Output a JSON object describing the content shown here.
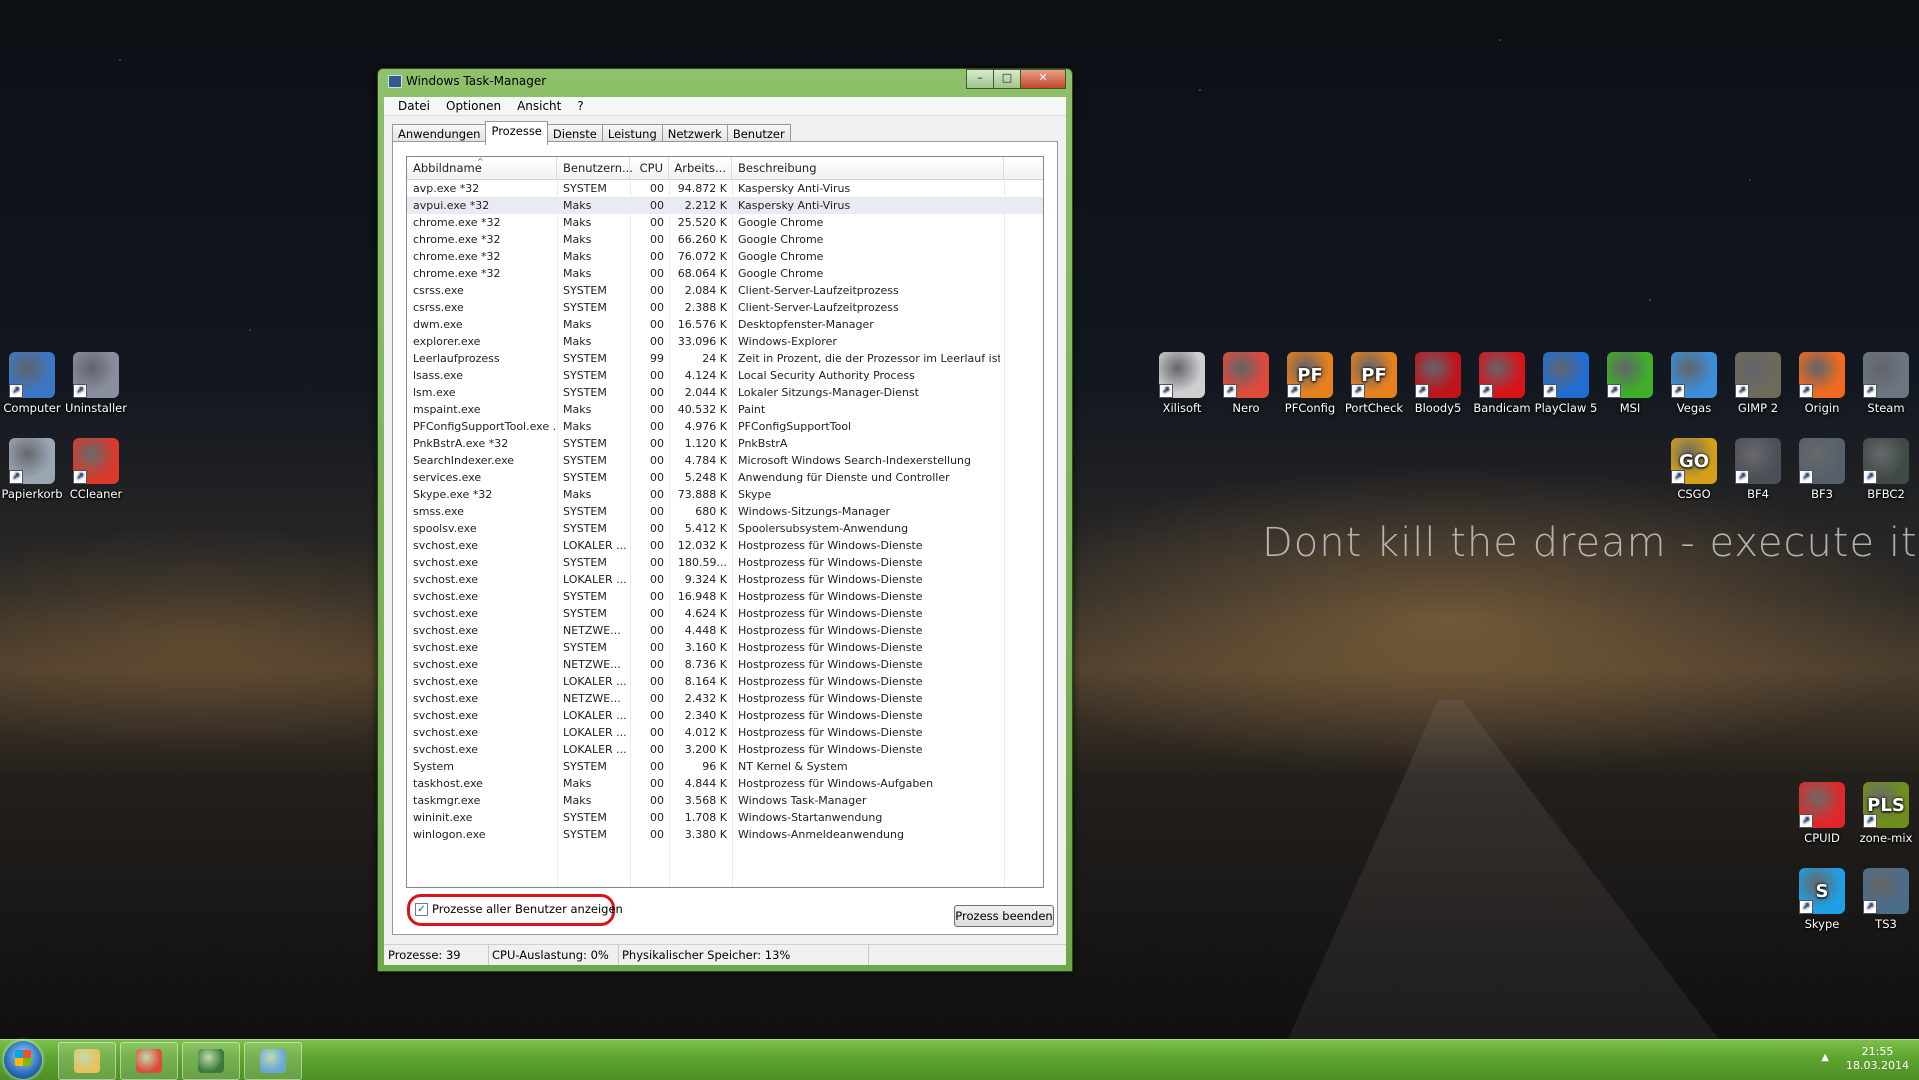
{
  "desktop": {
    "slogan": "Dont kill the dream - execute it",
    "left_icons": [
      {
        "label": "Computer",
        "icon": "computer-icon",
        "color": "#3a78c6"
      },
      {
        "label": "Uninstaller",
        "icon": "uninstaller-icon",
        "color": "#8a8fa0"
      },
      {
        "label": "Papierkorb",
        "icon": "recycle-bin-icon",
        "color": "#9aa6b4"
      },
      {
        "label": "CCleaner",
        "icon": "ccleaner-icon",
        "color": "#d93a2b"
      }
    ],
    "right_icons_row1": [
      {
        "label": "Xilisoft",
        "icon": "xilisoft-icon",
        "color": "#cfcfcf"
      },
      {
        "label": "Nero",
        "icon": "nero-icon",
        "color": "#e04a3a"
      },
      {
        "label": "PFConfig",
        "icon": "pfconfig-icon",
        "color": "#e8801c",
        "glyph": "PF"
      },
      {
        "label": "PortCheck",
        "icon": "portcheck-icon",
        "color": "#e8801c",
        "glyph": "PF"
      },
      {
        "label": "Bloody5",
        "icon": "bloody5-icon",
        "color": "#c0141b"
      },
      {
        "label": "Bandicam",
        "icon": "bandicam-icon",
        "color": "#d8141a"
      },
      {
        "label": "PlayClaw 5",
        "icon": "playclaw-icon",
        "color": "#1f6ed4"
      },
      {
        "label": "MSI",
        "icon": "msi-icon",
        "color": "#3fae2a"
      },
      {
        "label": "Vegas",
        "icon": "vegas-icon",
        "color": "#3b8fd8"
      },
      {
        "label": "GIMP 2",
        "icon": "gimp-icon",
        "color": "#6e6a5a"
      },
      {
        "label": "Origin",
        "icon": "origin-icon",
        "color": "#f06b1f"
      },
      {
        "label": "Steam",
        "icon": "steam-icon",
        "color": "#6c7580"
      }
    ],
    "right_icons_row2": [
      {
        "label": "CSGO",
        "icon": "csgo-icon",
        "color": "#d4a017",
        "glyph": "GO"
      },
      {
        "label": "BF4",
        "icon": "bf4-icon",
        "color": "#4b4f57"
      },
      {
        "label": "BF3",
        "icon": "bf3-icon",
        "color": "#56606c"
      },
      {
        "label": "BFBC2",
        "icon": "bfbc2-icon",
        "color": "#3f4a45"
      }
    ],
    "right_icons_row3": [
      {
        "label": "CPUID",
        "icon": "cpuid-icon",
        "color": "#e0282a"
      },
      {
        "label": "zone-mix",
        "icon": "zone-mix-icon",
        "color": "#6e8f1c",
        "glyph": "PLS"
      }
    ],
    "right_icons_row4": [
      {
        "label": "Skype",
        "icon": "skype-icon",
        "color": "#1ea0e6",
        "glyph": "S"
      },
      {
        "label": "TS3",
        "icon": "teamspeak-icon",
        "color": "#4a6d8c"
      }
    ]
  },
  "window": {
    "title": "Windows Task-Manager",
    "menu": [
      "Datei",
      "Optionen",
      "Ansicht",
      "?"
    ],
    "tabs": [
      "Anwendungen",
      "Prozesse",
      "Dienste",
      "Leistung",
      "Netzwerk",
      "Benutzer"
    ],
    "active_tab": "Prozesse",
    "columns": [
      "Abbildname",
      "Benutzern...",
      "CPU",
      "Arbeits...",
      "Beschreibung"
    ],
    "processes": [
      [
        "avp.exe *32",
        "SYSTEM",
        "00",
        "94.872 K",
        "Kaspersky Anti-Virus"
      ],
      [
        "avpui.exe *32",
        "Maks",
        "00",
        "2.212 K",
        "Kaspersky Anti-Virus"
      ],
      [
        "chrome.exe *32",
        "Maks",
        "00",
        "25.520 K",
        "Google Chrome"
      ],
      [
        "chrome.exe *32",
        "Maks",
        "00",
        "66.260 K",
        "Google Chrome"
      ],
      [
        "chrome.exe *32",
        "Maks",
        "00",
        "76.072 K",
        "Google Chrome"
      ],
      [
        "chrome.exe *32",
        "Maks",
        "00",
        "68.064 K",
        "Google Chrome"
      ],
      [
        "csrss.exe",
        "SYSTEM",
        "00",
        "2.084 K",
        "Client-Server-Laufzeitprozess"
      ],
      [
        "csrss.exe",
        "SYSTEM",
        "00",
        "2.388 K",
        "Client-Server-Laufzeitprozess"
      ],
      [
        "dwm.exe",
        "Maks",
        "00",
        "16.576 K",
        "Desktopfenster-Manager"
      ],
      [
        "explorer.exe",
        "Maks",
        "00",
        "33.096 K",
        "Windows-Explorer"
      ],
      [
        "Leerlaufprozess",
        "SYSTEM",
        "99",
        "24 K",
        "Zeit in Prozent, die der Prozessor im Leerlauf ist"
      ],
      [
        "lsass.exe",
        "SYSTEM",
        "00",
        "4.124 K",
        "Local Security Authority Process"
      ],
      [
        "lsm.exe",
        "SYSTEM",
        "00",
        "2.044 K",
        "Lokaler Sitzungs-Manager-Dienst"
      ],
      [
        "mspaint.exe",
        "Maks",
        "00",
        "40.532 K",
        "Paint"
      ],
      [
        "PFConfigSupportTool.exe ...",
        "Maks",
        "00",
        "4.976 K",
        "PFConfigSupportTool"
      ],
      [
        "PnkBstrA.exe *32",
        "SYSTEM",
        "00",
        "1.120 K",
        "PnkBstrA"
      ],
      [
        "SearchIndexer.exe",
        "SYSTEM",
        "00",
        "4.784 K",
        "Microsoft Windows Search-Indexerstellung"
      ],
      [
        "services.exe",
        "SYSTEM",
        "00",
        "5.248 K",
        "Anwendung für Dienste und Controller"
      ],
      [
        "Skype.exe *32",
        "Maks",
        "00",
        "73.888 K",
        "Skype"
      ],
      [
        "smss.exe",
        "SYSTEM",
        "00",
        "680 K",
        "Windows-Sitzungs-Manager"
      ],
      [
        "spoolsv.exe",
        "SYSTEM",
        "00",
        "5.412 K",
        "Spoolersubsystem-Anwendung"
      ],
      [
        "svchost.exe",
        "LOKALER ...",
        "00",
        "12.032 K",
        "Hostprozess für Windows-Dienste"
      ],
      [
        "svchost.exe",
        "SYSTEM",
        "00",
        "180.59...",
        "Hostprozess für Windows-Dienste"
      ],
      [
        "svchost.exe",
        "LOKALER ...",
        "00",
        "9.324 K",
        "Hostprozess für Windows-Dienste"
      ],
      [
        "svchost.exe",
        "SYSTEM",
        "00",
        "16.948 K",
        "Hostprozess für Windows-Dienste"
      ],
      [
        "svchost.exe",
        "SYSTEM",
        "00",
        "4.624 K",
        "Hostprozess für Windows-Dienste"
      ],
      [
        "svchost.exe",
        "NETZWE...",
        "00",
        "4.448 K",
        "Hostprozess für Windows-Dienste"
      ],
      [
        "svchost.exe",
        "SYSTEM",
        "00",
        "3.160 K",
        "Hostprozess für Windows-Dienste"
      ],
      [
        "svchost.exe",
        "NETZWE...",
        "00",
        "8.736 K",
        "Hostprozess für Windows-Dienste"
      ],
      [
        "svchost.exe",
        "LOKALER ...",
        "00",
        "8.164 K",
        "Hostprozess für Windows-Dienste"
      ],
      [
        "svchost.exe",
        "NETZWE...",
        "00",
        "2.432 K",
        "Hostprozess für Windows-Dienste"
      ],
      [
        "svchost.exe",
        "LOKALER ...",
        "00",
        "2.340 K",
        "Hostprozess für Windows-Dienste"
      ],
      [
        "svchost.exe",
        "LOKALER ...",
        "00",
        "4.012 K",
        "Hostprozess für Windows-Dienste"
      ],
      [
        "svchost.exe",
        "LOKALER ...",
        "00",
        "3.200 K",
        "Hostprozess für Windows-Dienste"
      ],
      [
        "System",
        "SYSTEM",
        "00",
        "96 K",
        "NT Kernel & System"
      ],
      [
        "taskhost.exe",
        "Maks",
        "00",
        "4.844 K",
        "Hostprozess für Windows-Aufgaben"
      ],
      [
        "taskmgr.exe",
        "Maks",
        "00",
        "3.568 K",
        "Windows Task-Manager"
      ],
      [
        "wininit.exe",
        "SYSTEM",
        "00",
        "1.708 K",
        "Windows-Startanwendung"
      ],
      [
        "winlogon.exe",
        "SYSTEM",
        "00",
        "3.380 K",
        "Windows-Anmeldeanwendung"
      ]
    ],
    "selected_row": 1,
    "show_all_users_label": "Prozesse aller Benutzer anzeigen",
    "show_all_users_checked": true,
    "end_process_button": "Prozess beenden",
    "status": {
      "processes": "Prozesse: 39",
      "cpu": "CPU-Auslastung: 0%",
      "memory": "Physikalischer Speicher: 13%"
    }
  },
  "taskbar": {
    "pinned": [
      {
        "name": "explorer",
        "icon": "folder-icon",
        "color": "#e8c25a"
      },
      {
        "name": "chrome",
        "icon": "chrome-icon",
        "color": "#dd4b39"
      },
      {
        "name": "taskmgr",
        "icon": "task-manager-icon",
        "color": "#3c7a3a"
      },
      {
        "name": "paint",
        "icon": "paint-icon",
        "color": "#6aa7d8"
      }
    ],
    "clock_time": "21:55",
    "clock_date": "18.03.2014"
  }
}
